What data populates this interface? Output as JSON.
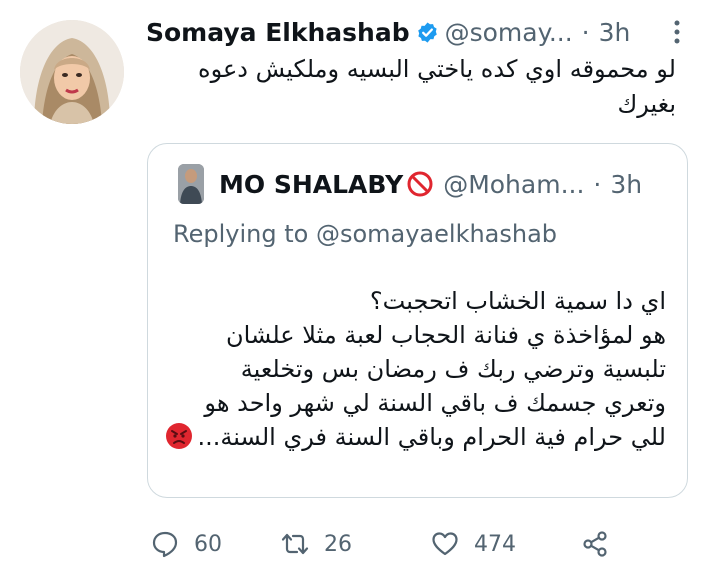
{
  "tweet": {
    "author": {
      "display_name": "Somaya Elkhashab",
      "handle": "@somay...",
      "verified": true
    },
    "separator": "·",
    "time": "3h",
    "text": "لو محموقه اوي كده ياختي البسيه وملكيش دعوه بغيرك",
    "more_icon": "more-icon"
  },
  "quote": {
    "author": {
      "display_name": "MO SHALABY",
      "name_emoji": "no-entry-icon",
      "handle": "@Moham..."
    },
    "separator": "·",
    "time": "3h",
    "replying_prefix": "Replying to",
    "replying_mention": "@somayaelkhashab",
    "text_lines": [
      "اي دا سمية الخشاب اتحجبت؟",
      "هو لمؤاخذة ي فنانة الحجاب لعبة مثلا علشان",
      "تلبسية وترضي ربك ف رمضان بس وتخلعية",
      "وتعري جسمك ف باقي السنة لي شهر واحد هو",
      "للي حرام فية الحرام وباقي السنة فري السنة..."
    ],
    "trailing_emoji": "angry-face-icon"
  },
  "actions": {
    "reply": {
      "icon": "reply-icon",
      "count": "60"
    },
    "retweet": {
      "icon": "retweet-icon",
      "count": "26"
    },
    "like": {
      "icon": "heart-icon",
      "count": "474"
    },
    "share": {
      "icon": "share-icon"
    }
  },
  "colors": {
    "text": "#0f1419",
    "secondary": "#536471",
    "border": "#cfd9de",
    "verified": "#1d9bf0",
    "no_entry": "#e0262f"
  }
}
